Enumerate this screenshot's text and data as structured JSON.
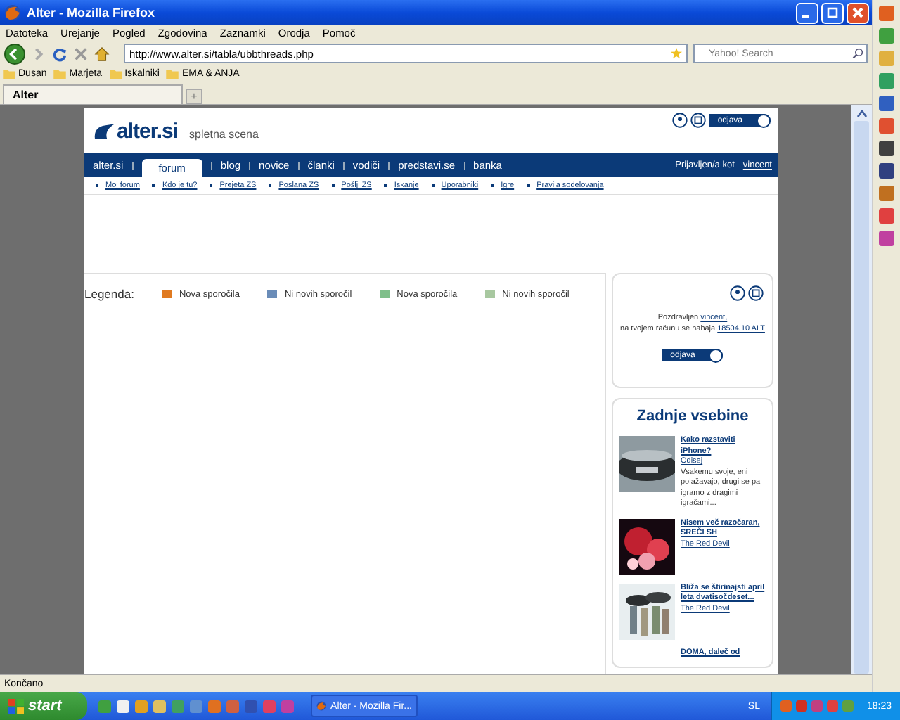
{
  "window": {
    "title": "Alter - Mozilla Firefox"
  },
  "menu": [
    "Datoteka",
    "Urejanje",
    "Pogled",
    "Zgodovina",
    "Zaznamki",
    "Orodja",
    "Pomoč"
  ],
  "address": {
    "value": "http://www.alter.si/tabla/ubbthreads.php"
  },
  "search": {
    "placeholder": "Yahoo! Search"
  },
  "bookmarks": [
    "Dusan",
    "Marjeta",
    "Iskalniki",
    "EMA & ANJA"
  ],
  "tabs": [
    {
      "label": "Alter",
      "selected": true
    }
  ],
  "new_tab": "+",
  "site": {
    "logo": "alter.si",
    "tagline": "spletna scena",
    "logout": "odjava",
    "nav": [
      {
        "label": "alter.si",
        "selected": false
      },
      {
        "label": "forum",
        "selected": true
      },
      {
        "label": "blog",
        "selected": false
      },
      {
        "label": "novice",
        "selected": false
      },
      {
        "label": "članki",
        "selected": false
      },
      {
        "label": "vodiči",
        "selected": false
      },
      {
        "label": "predstavi.se",
        "selected": false
      },
      {
        "label": "banka",
        "selected": false
      }
    ],
    "login_label": "Prijavljen/a kot",
    "login_user": "vincent",
    "subnav": [
      "Moj forum",
      "Kdo je tu?",
      "Prejeta ZS",
      "Poslana ZS",
      "Pošlji ZS",
      "Iskanje",
      "Uporabniki",
      "Igre",
      "Pravila sodelovanja"
    ]
  },
  "legend": {
    "label": "Legenda:",
    "items": [
      {
        "label": "Nova sporočila",
        "color": "#e07a20"
      },
      {
        "label": "Ni novih sporočil",
        "color": "#6a8cb8"
      },
      {
        "label": "Nova sporočila",
        "color": "#7fbf8a"
      },
      {
        "label": "Ni novih sporočil",
        "color": "#a8c8a0"
      }
    ]
  },
  "account": {
    "greeting": "Pozdravljen",
    "user": "vincent,",
    "balance_text": "na tvojem računu se nahaja",
    "balance": "18504.10 ALT",
    "logout": "odjava"
  },
  "latest": {
    "title": "Zadnje vsebine",
    "articles": [
      {
        "title": "Kako razstaviti iPhone?",
        "author": "Odisej",
        "excerpt": "Vsakemu svoje, eni polažavajo, drugi se pa igramo z dragimi igračami...",
        "kind": "picture"
      },
      {
        "title": "Nisem več razočaran, SREČI SH",
        "author": "The Red Devil",
        "kind": "picture"
      },
      {
        "title": "Bliža se štirinajsti april leta dvatisočdeset...",
        "author": "The Red Devil",
        "kind": "picture"
      },
      {
        "title": "DOMA, daleč od"
      }
    ]
  },
  "status_bar": "Končano",
  "taskbar": {
    "start": "start",
    "task": "Alter - Mozilla Fir...",
    "language": "SL",
    "clock": "18:23"
  }
}
